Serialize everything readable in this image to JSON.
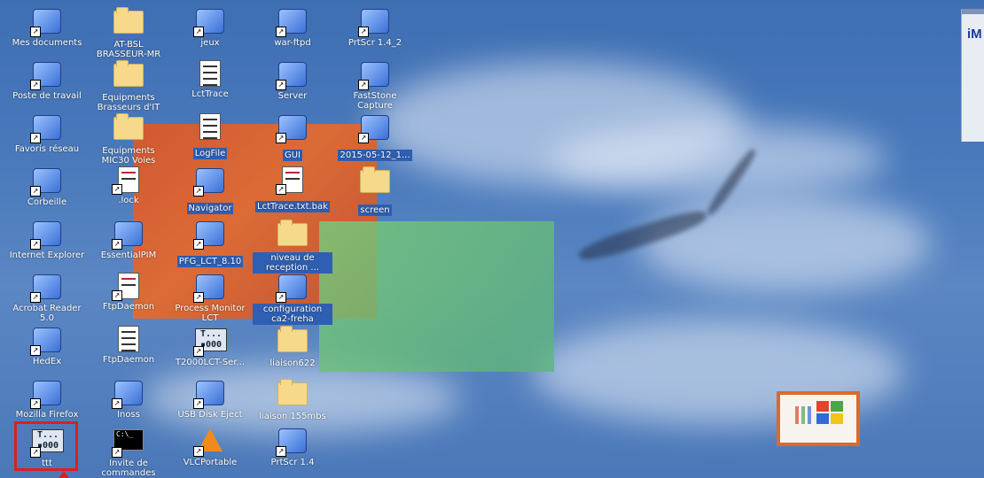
{
  "desktop": {
    "icons": [
      {
        "name": "mes-documents-icon",
        "label": "Mes documents",
        "kind": "special",
        "x": "left",
        "col": 0,
        "row": 0
      },
      {
        "name": "poste-de-travail-icon",
        "label": "Poste de travail",
        "kind": "special",
        "col": 0,
        "row": 1
      },
      {
        "name": "favoris-reseau-icon",
        "label": "Favoris réseau",
        "kind": "special",
        "col": 0,
        "row": 2
      },
      {
        "name": "corbeille-icon",
        "label": "Corbeille",
        "kind": "special",
        "col": 0,
        "row": 3
      },
      {
        "name": "internet-explorer-icon",
        "label": "Internet Explorer",
        "kind": "special",
        "col": 0,
        "row": 4
      },
      {
        "name": "acrobat-reader-icon",
        "label": "Acrobat Reader 5.0",
        "kind": "special",
        "col": 0,
        "row": 5
      },
      {
        "name": "hedex-icon",
        "label": "HedEx",
        "kind": "special",
        "col": 0,
        "row": 6
      },
      {
        "name": "mozilla-firefox-icon",
        "label": "Mozilla Firefox",
        "kind": "special",
        "col": 0,
        "row": 7
      },
      {
        "name": "ttt-icon",
        "label": "ttt",
        "kind": "t2000",
        "col": 0,
        "row": 8
      },
      {
        "name": "at-bsl-folder",
        "label": "AT-BSL BRASSEUR-MR",
        "kind": "folder",
        "col": 1,
        "row": 0
      },
      {
        "name": "equipments-brasseurs-folder",
        "label": "Equipments Brasseurs d'IT",
        "kind": "folder",
        "col": 1,
        "row": 1
      },
      {
        "name": "equipments-mic30-folder",
        "label": "Equipments MIC30 Voies",
        "kind": "folder",
        "col": 1,
        "row": 2
      },
      {
        "name": "lock-file-icon",
        "label": ".lock",
        "kind": "file",
        "col": 1,
        "row": 3
      },
      {
        "name": "essentialpim-icon",
        "label": "EssentialPIM",
        "kind": "special",
        "col": 1,
        "row": 4
      },
      {
        "name": "ftpdaemon-icon-1",
        "label": "FtpDaemon",
        "kind": "file",
        "col": 1,
        "row": 5
      },
      {
        "name": "ftpdaemon-icon-2",
        "label": "FtpDaemon",
        "kind": "doc",
        "col": 1,
        "row": 6
      },
      {
        "name": "inoss-icon",
        "label": "Inoss",
        "kind": "special",
        "col": 1,
        "row": 7
      },
      {
        "name": "invite-de-commandes-icon",
        "label": "Invite de commandes",
        "kind": "cmd",
        "col": 1,
        "row": 8
      },
      {
        "name": "jeux-icon",
        "label": "jeux",
        "kind": "special",
        "col": 2,
        "row": 0
      },
      {
        "name": "lcttrace-icon",
        "label": "LctTrace",
        "kind": "doc",
        "col": 2,
        "row": 1
      },
      {
        "name": "logfile-icon",
        "label": "LogFile",
        "kind": "doc",
        "col": 2,
        "row": 2
      },
      {
        "name": "navigator-icon",
        "label": "Navigator",
        "kind": "special",
        "col": 2,
        "row": 3
      },
      {
        "name": "pfg-lct-icon",
        "label": "PFG_LCT_8.10",
        "kind": "special",
        "col": 2,
        "row": 4
      },
      {
        "name": "process-monitor-icon",
        "label": "Process Monitor LCT",
        "kind": "special",
        "col": 2,
        "row": 5
      },
      {
        "name": "t2000lct-server-icon",
        "label": "T2000LCT-Ser...",
        "kind": "t2000",
        "col": 2,
        "row": 6
      },
      {
        "name": "usb-disk-eject-icon",
        "label": "USB Disk Eject",
        "kind": "special",
        "col": 2,
        "row": 7
      },
      {
        "name": "vlcportable-icon",
        "label": "VLCPortable",
        "kind": "vlc",
        "col": 2,
        "row": 8
      },
      {
        "name": "war-ftpd-icon",
        "label": "war-ftpd",
        "kind": "special",
        "col": 3,
        "row": 0
      },
      {
        "name": "server-icon",
        "label": "Server",
        "kind": "special",
        "col": 3,
        "row": 1
      },
      {
        "name": "gui-icon",
        "label": "GUI",
        "kind": "special",
        "col": 3,
        "row": 2
      },
      {
        "name": "lcttrace-bak-icon",
        "label": "LctTrace.txt.bak",
        "kind": "file",
        "col": 3,
        "row": 3
      },
      {
        "name": "niveau-de-reception-folder",
        "label": "niveau de reception ...",
        "kind": "folder",
        "col": 3,
        "row": 4
      },
      {
        "name": "configuration-ca2-icon",
        "label": "configuration ca2-freha",
        "kind": "special",
        "col": 3,
        "row": 5
      },
      {
        "name": "liaison622-folder",
        "label": "liaison622",
        "kind": "folder",
        "col": 3,
        "row": 6
      },
      {
        "name": "liaison-155mbs-folder",
        "label": "liaison 155mbs",
        "kind": "folder",
        "col": 3,
        "row": 7
      },
      {
        "name": "prtscr-14-icon",
        "label": "PrtScr 1.4",
        "kind": "special",
        "col": 3,
        "row": 8
      },
      {
        "name": "prtscr-14-2-icon",
        "label": "PrtScr 1.4_2",
        "kind": "special",
        "col": 4,
        "row": 0
      },
      {
        "name": "faststone-capture-icon",
        "label": "FastStone Capture",
        "kind": "special",
        "col": 4,
        "row": 1
      },
      {
        "name": "screenshot-2015-icon",
        "label": "2015-05-12_1...",
        "kind": "special",
        "col": 4,
        "row": 2
      },
      {
        "name": "screen-folder",
        "label": "screen",
        "kind": "folder",
        "col": 4,
        "row": 3
      }
    ]
  },
  "right_widget": {
    "text": "iM"
  }
}
